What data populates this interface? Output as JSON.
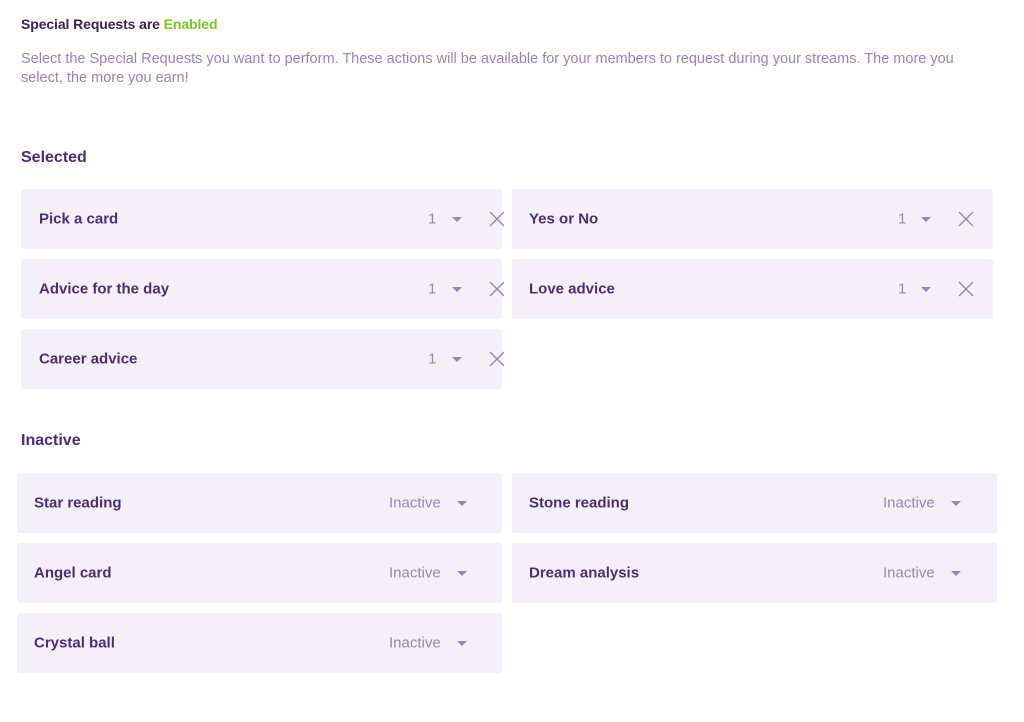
{
  "header": {
    "status_prefix": "Special Requests are ",
    "status_value": "Enabled",
    "description": "Select the Special Requests you want to perform. These actions will be available for your members to request during your streams. The more you select, the more you earn!"
  },
  "selected": {
    "title": "Selected",
    "items": [
      {
        "label": "Pick a card",
        "quantity": "1"
      },
      {
        "label": "Yes or No",
        "quantity": "1"
      },
      {
        "label": "Advice for the day",
        "quantity": "1"
      },
      {
        "label": "Love advice",
        "quantity": "1"
      },
      {
        "label": "Career advice",
        "quantity": "1"
      }
    ]
  },
  "inactive": {
    "title": "Inactive",
    "items": [
      {
        "label": "Star reading",
        "status": "Inactive"
      },
      {
        "label": "Stone reading",
        "status": "Inactive"
      },
      {
        "label": "Angel card",
        "status": "Inactive"
      },
      {
        "label": "Dream analysis",
        "status": "Inactive"
      },
      {
        "label": "Crystal ball",
        "status": "Inactive"
      }
    ]
  },
  "colors": {
    "enabled": "#7ac91f",
    "primary_text": "#4d2d73",
    "muted_text": "#9a86b4",
    "card_bg": "#f3f0f8"
  },
  "icons": {
    "remove": "close-icon",
    "dropdown": "caret-down-icon"
  }
}
